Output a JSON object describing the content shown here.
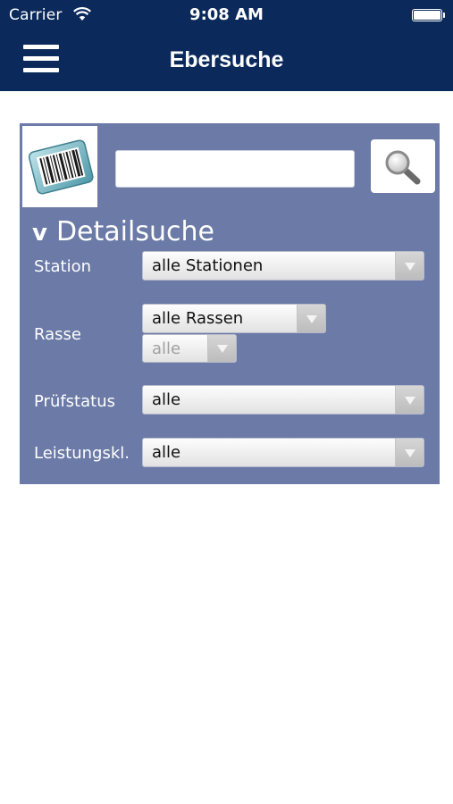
{
  "status_bar": {
    "carrier": "Carrier",
    "time": "9:08 AM"
  },
  "nav": {
    "title": "Ebersuche",
    "menu_icon": "hamburger-menu-icon"
  },
  "search": {
    "value": "",
    "barcode_icon": "barcode-icon",
    "search_icon": "magnifier-icon"
  },
  "detail": {
    "toggle_symbol": "v",
    "title": "Detailsuche",
    "station": {
      "label": "Station",
      "selected": "alle Stationen"
    },
    "rasse": {
      "label": "Rasse",
      "selected": "alle Rassen",
      "sub_selected": "alle"
    },
    "pruefstatus": {
      "label": "Prüfstatus",
      "selected": "alle"
    },
    "leistungskl": {
      "label": "Leistungskl.",
      "selected": "alle"
    }
  },
  "colors": {
    "nav_background": "#0b2a5b",
    "panel_background": "#6b7aa6"
  }
}
